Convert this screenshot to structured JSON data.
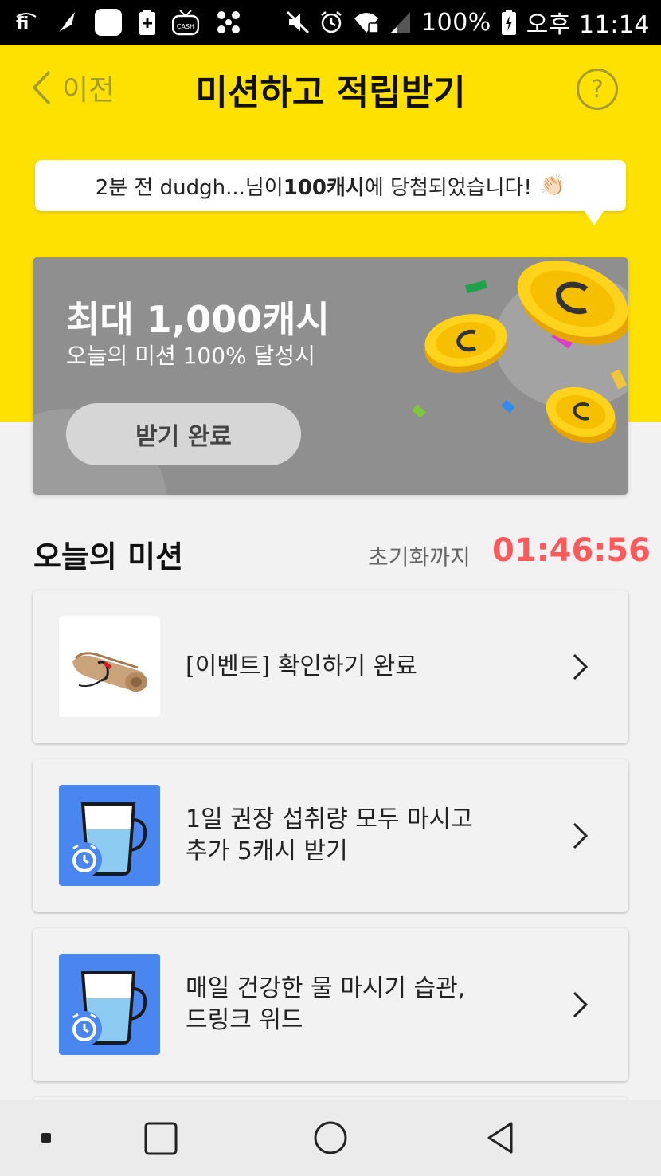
{
  "status_bar": {
    "battery_percent": "100%",
    "time": "오후 11:14",
    "left_icons": [
      "fi-icon",
      "feather-icon",
      "blank-app-icon",
      "battery-plus-icon",
      "cash-tv-icon",
      "dots-icon"
    ],
    "cash_badge": "CASH",
    "right_icons": [
      "mute-icon",
      "alarm-icon",
      "wifi-icon",
      "signal-icon",
      "battery-charging-icon"
    ]
  },
  "header": {
    "back_label": "이전",
    "title": "미션하고 적립받기",
    "help_symbol": "?"
  },
  "notice": {
    "prefix": "2분 전 dudgh...님이 ",
    "highlight": "100캐시",
    "suffix": "에 당첨되었습니다!",
    "emoji": "👏🏻"
  },
  "reward_card": {
    "title": "최대 1,000캐시",
    "subtitle": "오늘의 미션 100% 달성시",
    "button_label": "받기 완료"
  },
  "missions_section": {
    "title": "오늘의 미션",
    "reset_label": "초기화까지",
    "reset_timer": "01:46:56"
  },
  "missions": [
    {
      "line1": "[이벤트] 확인하기 완료",
      "line2": "",
      "thumb": "scroll-icon"
    },
    {
      "line1": "1일 권장 섭취량 모두 마시고",
      "line2": "추가 5캐시 받기",
      "thumb": "water-cup-alarm-icon"
    },
    {
      "line1": "매일 건강한 물 마시기 습관,",
      "line2": "드링크 위드",
      "thumb": "water-cup-alarm-icon"
    }
  ],
  "colors": {
    "header_yellow": "#ffe100",
    "timer_red": "#ff5a5a",
    "card_gray": "#8f8f8f",
    "thumb_blue": "#4a86f0"
  }
}
